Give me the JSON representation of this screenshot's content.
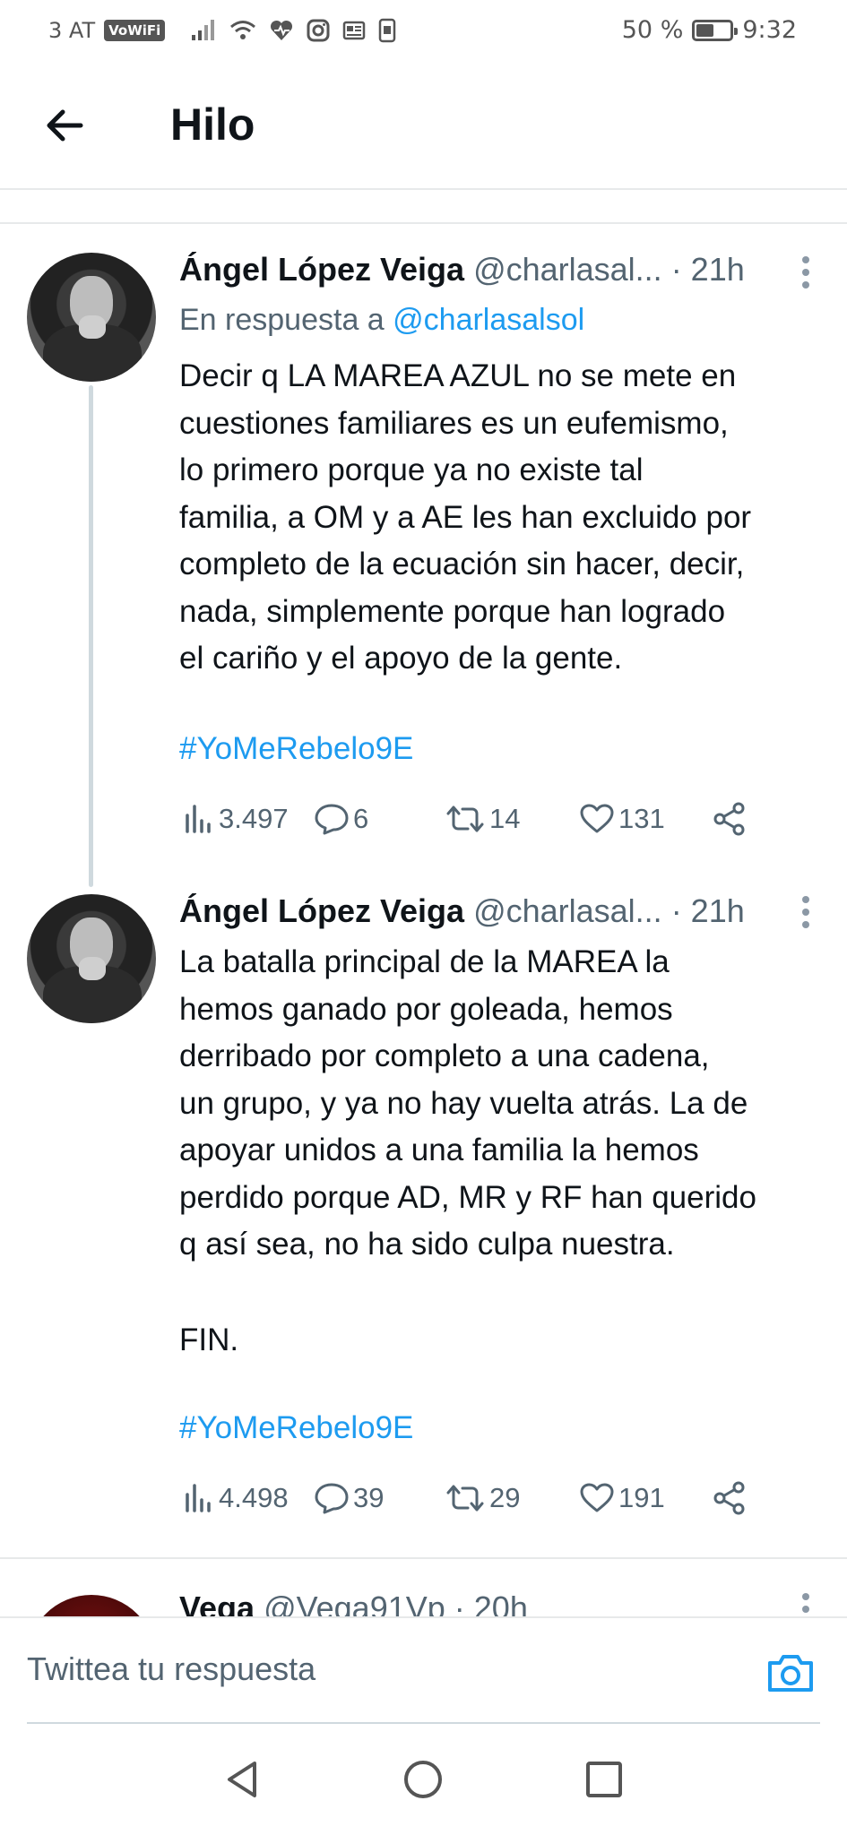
{
  "status_bar": {
    "carrier": "3 AT",
    "vowifi": "VoWiFi",
    "battery_percent": "50 %",
    "battery_level": 0.5,
    "time": "9:32"
  },
  "header": {
    "title": "Hilo"
  },
  "tweets": [
    {
      "name": "Ángel López Veiga",
      "handle": "@charlasal...",
      "time": "· 21h",
      "reply_prefix": "En respuesta a",
      "reply_handle": "@charlasalsol",
      "lines": [
        "Decir q LA MAREA AZUL no se mete en",
        "cuestiones familiares es un eufemismo,",
        "lo primero porque ya no existe tal",
        "familia, a OM y a AE les han excluido por",
        "completo de la ecuación sin hacer, decir,",
        "nada, simplemente porque han logrado",
        "el cariño y el apoyo de la gente."
      ],
      "hashtag": "#YoMeRebelo9E",
      "views": "3.497",
      "replies": "6",
      "retweets": "14",
      "likes": "131"
    },
    {
      "name": "Ángel López Veiga",
      "handle": "@charlasal...",
      "time": "· 21h",
      "lines": [
        "La batalla principal de la MAREA la",
        "hemos ganado por goleada, hemos",
        "derribado por completo a una cadena,",
        "un grupo, y ya no hay vuelta atrás. La de",
        "apoyar unidos a una familia la hemos",
        "perdido porque AD, MR y RF han querido",
        "q así sea, no ha sido culpa nuestra."
      ],
      "fin": "FIN.",
      "hashtag": "#YoMeRebelo9E",
      "views": "4.498",
      "replies": "39",
      "retweets": "29",
      "likes": "191"
    },
    {
      "name": "Vega",
      "handle": "@Vega91Vp",
      "time": "· 20h"
    }
  ],
  "compose": {
    "placeholder": "Twittea tu respuesta"
  },
  "icons": {
    "back": "arrow-left-icon",
    "more": "more-vertical-icon",
    "views": "bar-chart-icon",
    "reply": "speech-bubble-icon",
    "retweet": "retweet-icon",
    "like": "heart-icon",
    "share": "share-icon",
    "camera": "camera-icon"
  },
  "colors": {
    "link": "#1d9bf0",
    "secondary_text": "#536471",
    "primary_text": "#0f1419"
  }
}
